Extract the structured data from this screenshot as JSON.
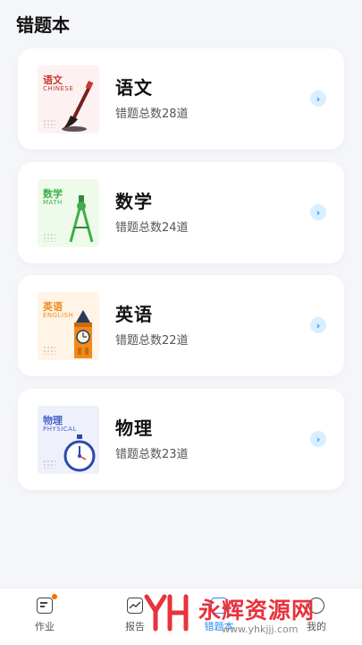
{
  "header": {
    "title": "错题本"
  },
  "subjects": [
    {
      "name": "语文",
      "count_text": "错题总数28道",
      "thumb_cn": "语文",
      "thumb_en": "CHINESE",
      "color": "#c8392f",
      "bg": "#fdf1f1",
      "icon": "brush-icon"
    },
    {
      "name": "数学",
      "count_text": "错题总数24道",
      "thumb_cn": "数学",
      "thumb_en": "MATH",
      "color": "#3fae4a",
      "bg": "#eefbea",
      "icon": "compass-icon"
    },
    {
      "name": "英语",
      "count_text": "错题总数22道",
      "thumb_cn": "英语",
      "thumb_en": "ENGLISH",
      "color": "#f08a1c",
      "bg": "#fff4e6",
      "icon": "clock-tower-icon"
    },
    {
      "name": "物理",
      "count_text": "错题总数23道",
      "thumb_cn": "物理",
      "thumb_en": "PHYSICAL",
      "color": "#4a62c8",
      "bg": "#eef1fc",
      "icon": "stopwatch-icon"
    }
  ],
  "tabs": [
    {
      "label": "作业",
      "icon": "homework-icon",
      "has_dot": true,
      "active": false
    },
    {
      "label": "报告",
      "icon": "report-icon",
      "active": false
    },
    {
      "label": "错题本",
      "icon": "notebook-icon",
      "active": true
    },
    {
      "label": "我的",
      "icon": "profile-icon",
      "active": false
    }
  ],
  "watermark": {
    "text": "永辉资源网",
    "url": "www.yhkjjj.com"
  }
}
